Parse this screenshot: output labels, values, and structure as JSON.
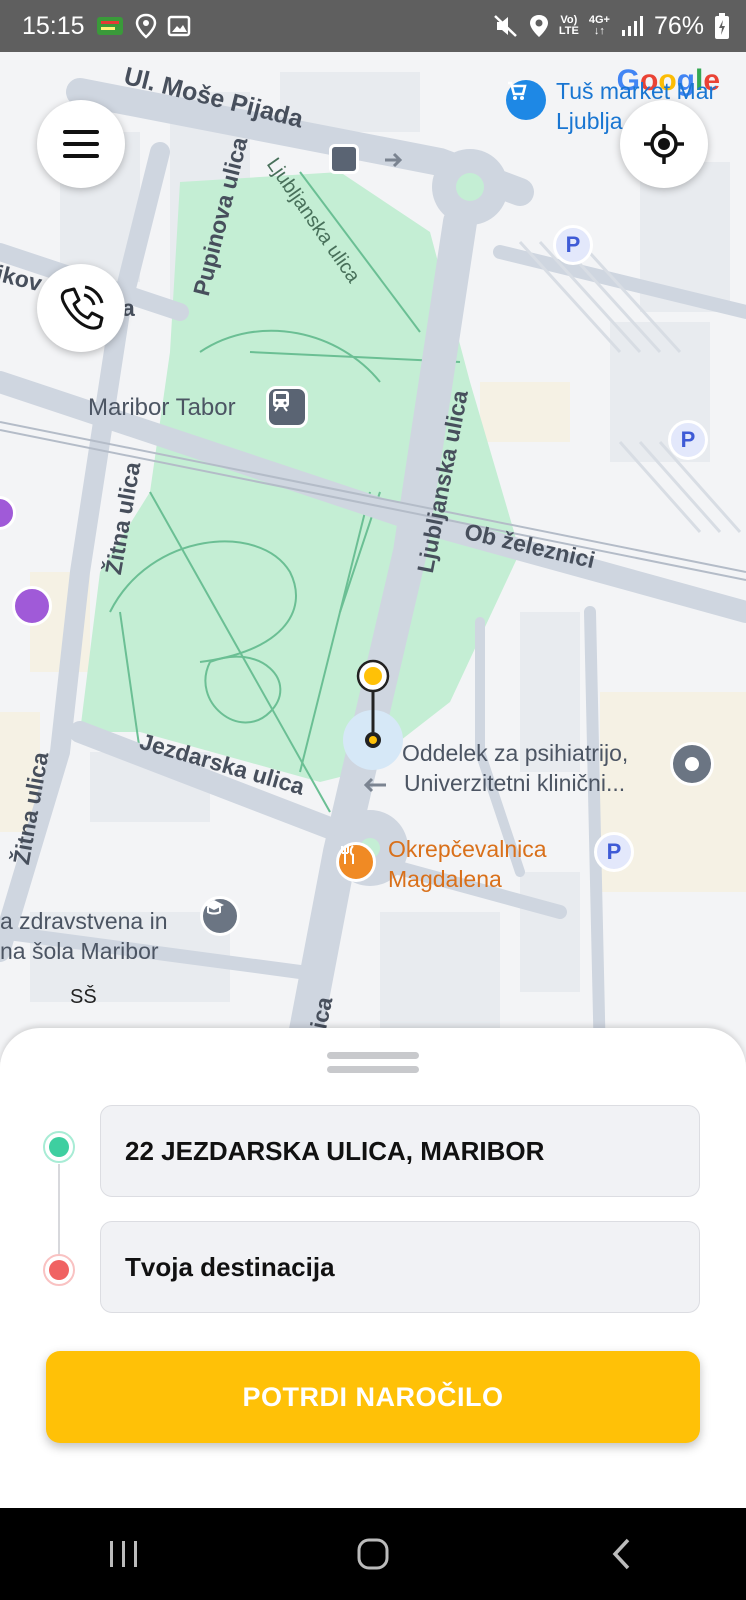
{
  "status_bar": {
    "time": "15:15",
    "network_top": "Vo)",
    "network_bottom": "LTE",
    "network_gen": "4G+",
    "battery": "76%",
    "icons": [
      "flash-app-icon",
      "location-icon",
      "image-icon",
      "mute-icon",
      "location-icon",
      "signal-icon",
      "battery-icon"
    ]
  },
  "map": {
    "google": "Google",
    "streets": {
      "mose_pijada": "Ul. Moše Pijada",
      "pupinova": "Pupinova ulica",
      "ljubljanska_top": "Ljubljanska ulica",
      "ljubljanska_main": "Ljubljanska ulica",
      "ob_zeleznici": "Ob železnici",
      "zitna_top": "Žitna ulica",
      "zitna_bottom": "Žitna ulica",
      "jezdarska": "Jezdarska ulica",
      "partial_left": "ikov",
      "partial_left_a": "a",
      "partial_bottom": "lica"
    },
    "pois": {
      "maribor_tabor": "Maribor Tabor",
      "tus_line1": "Tuš market Mar",
      "tus_line2": "Ljublja",
      "oddelek_line1": "Oddelek za psihiatrijo,",
      "oddelek_line2": "Univerzitetni klinični...",
      "okrep_line1": "Okrepčevalnica",
      "okrep_line2": "Magdalena",
      "sola_line1": "a zdravstvena in",
      "sola_line2": "na šola Maribor",
      "ss": "SŠ",
      "parking": "P"
    },
    "colors": {
      "park": "#c4eed4",
      "road": "#cfd6e0",
      "accent": "#ffc107"
    }
  },
  "buttons": {
    "menu_icon": "menu-icon",
    "locate_icon": "my-location-icon",
    "call_icon": "phone-call-icon"
  },
  "sheet": {
    "pickup": "22 JEZDARSKA ULICA, MARIBOR",
    "destination": "Tvoja destinacija",
    "confirm": "POTRDI NAROČILO",
    "pickup_color": "#3ecfa0",
    "destination_color": "#f06262"
  },
  "nav": {
    "icons": [
      "recent-apps-icon",
      "home-icon",
      "back-icon"
    ]
  }
}
